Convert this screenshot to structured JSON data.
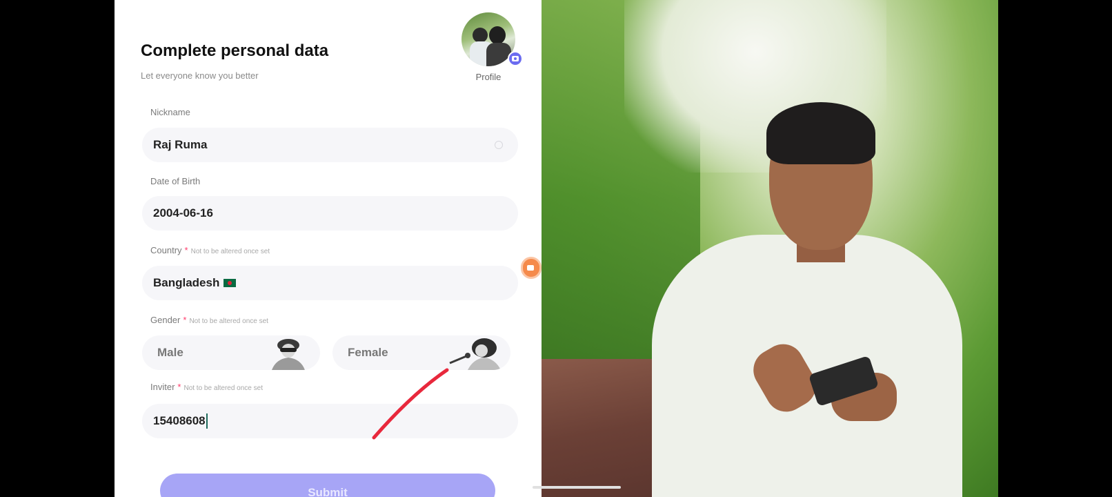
{
  "header": {
    "title": "Complete personal data",
    "subtitle": "Let everyone know you better",
    "profile_label": "Profile"
  },
  "form": {
    "nickname": {
      "label": "Nickname",
      "value": "Raj Ruma"
    },
    "dob": {
      "label": "Date of Birth",
      "value": "2004-06-16"
    },
    "country": {
      "label": "Country",
      "required_mark": "*",
      "note": "Not to be altered once set",
      "value": "Bangladesh"
    },
    "gender": {
      "label": "Gender",
      "required_mark": "*",
      "note": "Not to be altered once set",
      "male": "Male",
      "female": "Female"
    },
    "inviter": {
      "label": "Inviter",
      "required_mark": "*",
      "note": "Not to be altered once set",
      "value": "15408608"
    },
    "submit_label": "Submit"
  },
  "colors": {
    "accent": "#a7a5f6",
    "required": "#ff3b6b",
    "annotation_stroke": "#e8283c",
    "floating_button": "#f58a4b"
  }
}
